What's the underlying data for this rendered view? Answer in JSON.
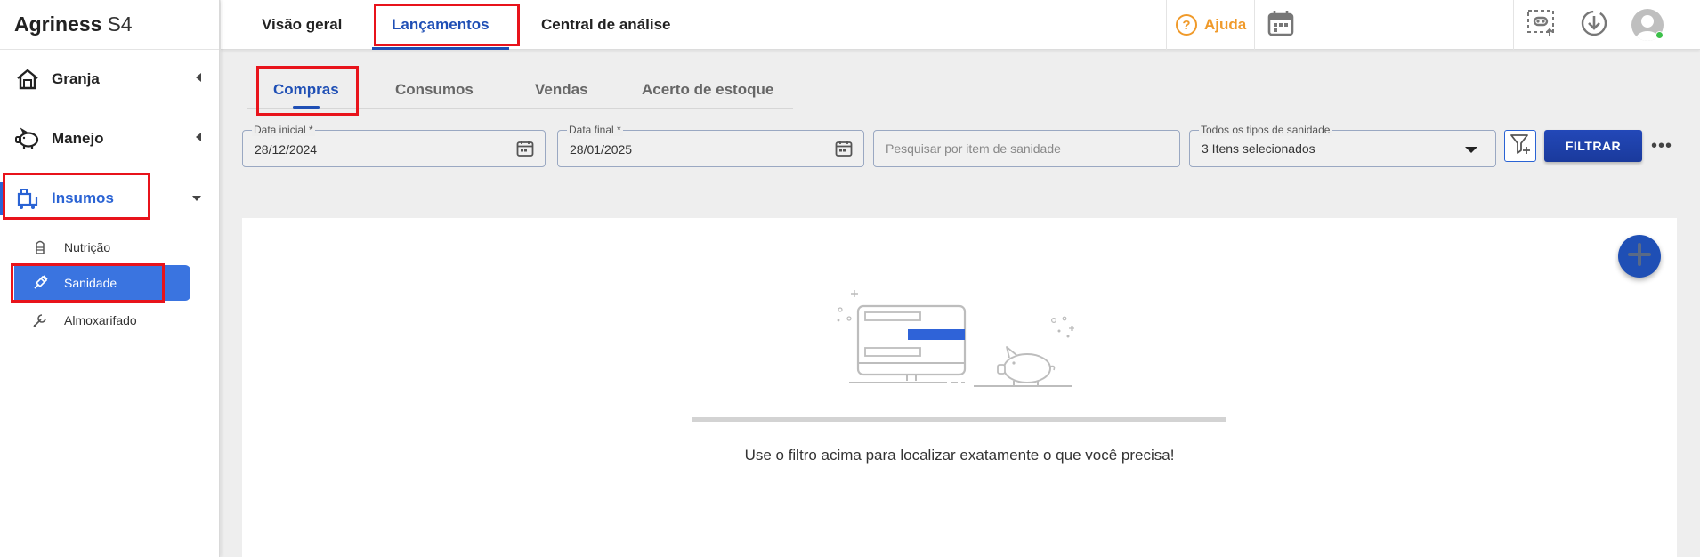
{
  "app": {
    "brand_name": "Agriness",
    "brand_version": "S4"
  },
  "sidebar": {
    "items": [
      {
        "label": "Granja",
        "icon": "barn-icon"
      },
      {
        "label": "Manejo",
        "icon": "pig-icon"
      },
      {
        "label": "Insumos",
        "icon": "supplies-cart-icon",
        "active": true
      }
    ],
    "subitems": [
      {
        "label": "Nutrição",
        "icon": "silo-icon"
      },
      {
        "label": "Sanidade",
        "icon": "syringe-icon",
        "active": true
      },
      {
        "label": "Almoxarifado",
        "icon": "wrench-icon"
      }
    ]
  },
  "topbar": {
    "tabs": [
      {
        "label": "Visão geral"
      },
      {
        "label": "Lançamentos",
        "active": true
      },
      {
        "label": "Central de análise"
      }
    ],
    "help_label": "Ajuda",
    "help_symbol": "?"
  },
  "subtabs": [
    {
      "label": "Compras",
      "active": true
    },
    {
      "label": "Consumos"
    },
    {
      "label": "Vendas"
    },
    {
      "label": "Acerto de estoque"
    }
  ],
  "filters": {
    "start_date": {
      "label": "Data inicial *",
      "value": "28/12/2024"
    },
    "end_date": {
      "label": "Data final *",
      "value": "28/01/2025"
    },
    "search": {
      "placeholder": "Pesquisar por item de sanidade"
    },
    "types": {
      "label": "Todos os tipos de sanidade",
      "value": "3 Itens selecionados"
    },
    "filter_button": "FILTRAR",
    "more_label": "•••"
  },
  "empty_state": {
    "message": "Use o filtro acima para localizar exatamente o que você precisa!"
  },
  "colors": {
    "primary": "#1f4fb5",
    "accent": "#2a63d4",
    "help": "#f09a2a",
    "highlight": "#e8131b"
  }
}
